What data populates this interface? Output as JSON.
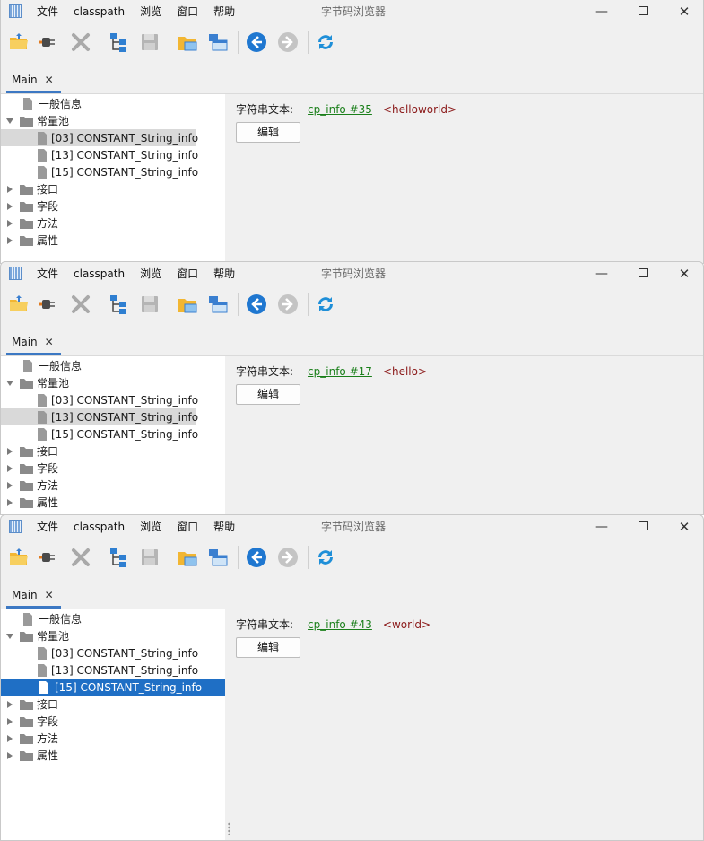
{
  "app": {
    "title": "字节码浏览器",
    "menu": [
      "文件",
      "classpath",
      "浏览",
      "窗口",
      "帮助"
    ],
    "controls": {
      "minimize": "—",
      "close": "✕"
    }
  },
  "toolbar": {
    "icons": [
      "open-folder-icon",
      "plugin-icon",
      "delete-icon",
      "tree-structure-icon",
      "save-icon",
      "folder-window-icon",
      "window-layout-icon",
      "back-arrow-icon",
      "forward-arrow-icon",
      "refresh-icon"
    ]
  },
  "tab": {
    "label": "Main",
    "close": "✕"
  },
  "tree": {
    "general": "一般信息",
    "constant_pool": "常量池",
    "children": [
      "[03] CONSTANT_String_info",
      "[13] CONSTANT_String_info",
      "[15] CONSTANT_String_info"
    ],
    "interfaces": "接口",
    "fields": "字段",
    "methods": "方法",
    "attributes": "属性"
  },
  "windows": [
    {
      "selected_index": 0,
      "selection_style": "grey",
      "detail": {
        "label": "字符串文本:",
        "link": "cp_info #35",
        "value": "<helloworld>",
        "button": "编辑"
      }
    },
    {
      "selected_index": 1,
      "selection_style": "grey",
      "detail": {
        "label": "字符串文本:",
        "link": "cp_info #17",
        "value": "<hello>",
        "button": "编辑"
      }
    },
    {
      "selected_index": 2,
      "selection_style": "blue",
      "detail": {
        "label": "字符串文本:",
        "link": "cp_info #43",
        "value": "<world>",
        "button": "编辑"
      }
    }
  ],
  "colors": {
    "accent": "#3c78c3",
    "selection_blue": "#1f6fc5",
    "link_green": "#1a7f1a",
    "value_red": "#8b1a1a"
  }
}
